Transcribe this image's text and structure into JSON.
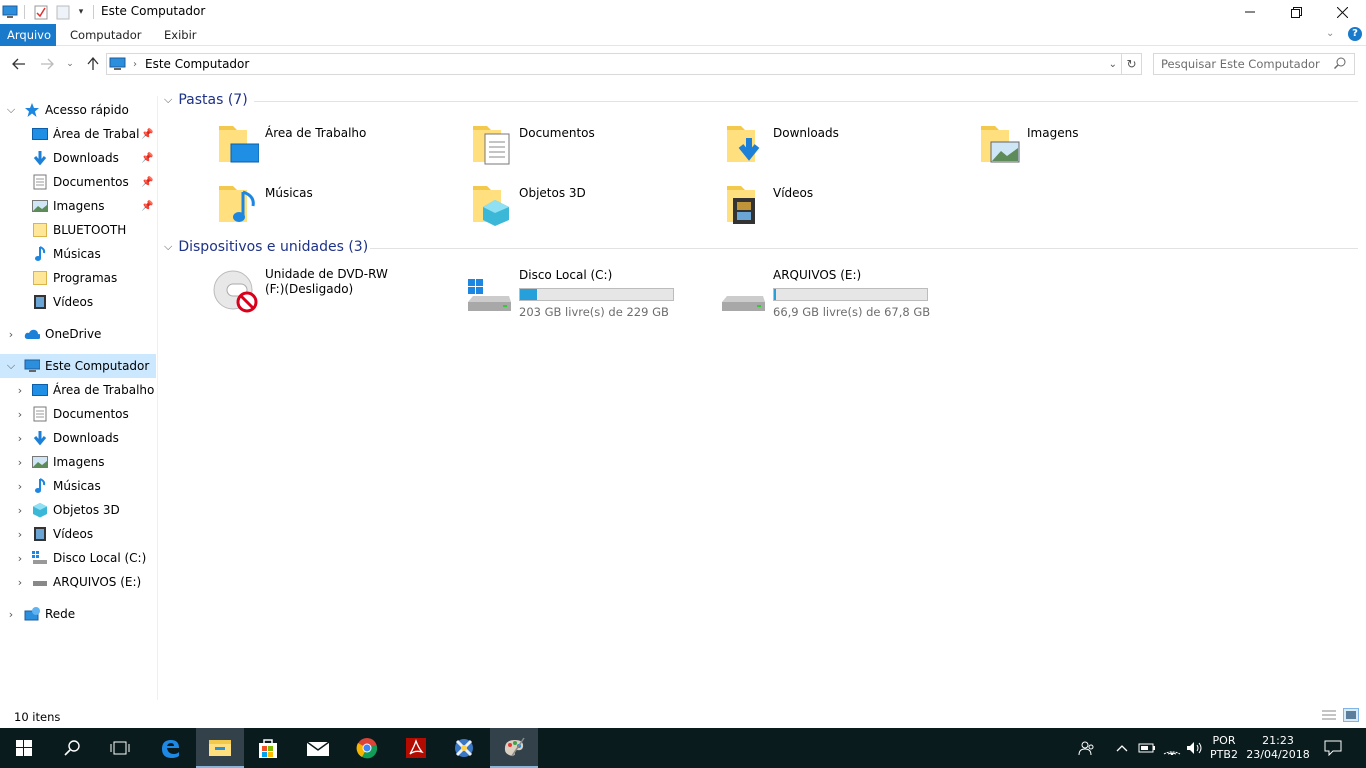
{
  "window": {
    "title": "Este Computador"
  },
  "ribbon": {
    "tabs": [
      "Arquivo",
      "Computador",
      "Exibir"
    ]
  },
  "address": {
    "path": "Este Computador",
    "search_placeholder": "Pesquisar Este Computador"
  },
  "nav": {
    "quick_access": {
      "label": "Acesso rápido",
      "items": [
        {
          "label": "Área de Trabalho",
          "icon": "desktop-icon",
          "pinned": true
        },
        {
          "label": "Downloads",
          "icon": "downloads-icon",
          "pinned": true
        },
        {
          "label": "Documentos",
          "icon": "documents-icon",
          "pinned": true
        },
        {
          "label": "Imagens",
          "icon": "pictures-icon",
          "pinned": true
        },
        {
          "label": "BLUETOOTH",
          "icon": "folder-icon",
          "pinned": false
        },
        {
          "label": "Músicas",
          "icon": "music-icon",
          "pinned": false
        },
        {
          "label": "Programas",
          "icon": "folder-icon",
          "pinned": false
        },
        {
          "label": "Vídeos",
          "icon": "videos-icon",
          "pinned": false
        }
      ]
    },
    "onedrive": {
      "label": "OneDrive"
    },
    "this_pc": {
      "label": "Este Computador",
      "items": [
        {
          "label": "Área de Trabalho",
          "icon": "desktop-icon"
        },
        {
          "label": "Documentos",
          "icon": "documents-icon"
        },
        {
          "label": "Downloads",
          "icon": "downloads-icon"
        },
        {
          "label": "Imagens",
          "icon": "pictures-icon"
        },
        {
          "label": "Músicas",
          "icon": "music-icon"
        },
        {
          "label": "Objetos 3D",
          "icon": "objects-3d-icon"
        },
        {
          "label": "Vídeos",
          "icon": "videos-icon"
        },
        {
          "label": "Disco Local (C:)",
          "icon": "local-disk-icon"
        },
        {
          "label": "ARQUIVOS (E:)",
          "icon": "drive-icon"
        }
      ]
    },
    "network": {
      "label": "Rede"
    }
  },
  "folders": {
    "header": "Pastas (7)",
    "items": [
      {
        "label": "Área de Trabalho",
        "icon": "desktop-folder-icon"
      },
      {
        "label": "Documentos",
        "icon": "documents-folder-icon"
      },
      {
        "label": "Downloads",
        "icon": "downloads-folder-icon"
      },
      {
        "label": "Imagens",
        "icon": "pictures-folder-icon"
      },
      {
        "label": "Músicas",
        "icon": "music-folder-icon"
      },
      {
        "label": "Objetos 3D",
        "icon": "objects-3d-folder-icon"
      },
      {
        "label": "Vídeos",
        "icon": "videos-folder-icon"
      }
    ]
  },
  "devices": {
    "header": "Dispositivos e unidades (3)",
    "items": [
      {
        "label": "Unidade de DVD-RW (F:)(Desligado)",
        "line1": "Unidade de DVD-RW",
        "line2": "(F:)(Desligado)",
        "icon": "dvd-disconnected-icon"
      },
      {
        "label": "Disco Local (C:)",
        "free": "203 GB livre(s) de 229 GB",
        "used_fraction": 0.114,
        "icon": "windows-drive-icon"
      },
      {
        "label": "ARQUIVOS (E:)",
        "free": "66,9 GB livre(s) de 67,8 GB",
        "used_fraction": 0.013,
        "icon": "drive-icon"
      }
    ]
  },
  "status": {
    "count": "10 itens"
  },
  "taskbar": {
    "lang1": "POR",
    "lang2": "PTB2",
    "time": "21:23",
    "date": "23/04/2018"
  },
  "colors": {
    "accent": "#1979ca",
    "selection": "#cce8ff",
    "bar_fill": "#26a0da",
    "header_blue": "#1e3287",
    "taskbar": "#0a1b1e"
  }
}
